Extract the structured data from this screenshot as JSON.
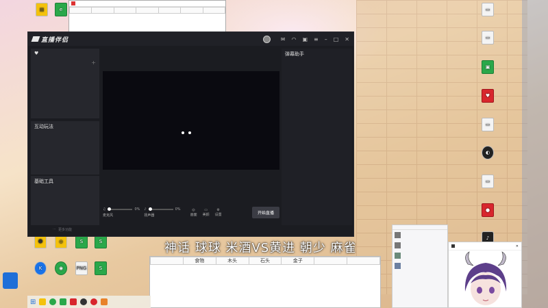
{
  "top_table": {
    "columns": [
      "",
      "",
      "",
      "",
      "",
      "",
      ""
    ]
  },
  "app": {
    "logo_text": "直播伴侣",
    "left_bottom_btn": "更多功能",
    "section_interactive": "互动玩法",
    "section_basic_tools": "基础工具",
    "right_title": "弹幕助手",
    "right_status": "",
    "ctrl_mic_label": "麦克风",
    "ctrl_mic_value": "0%",
    "ctrl_speaker_label": "扬声器",
    "ctrl_speaker_value": "0%",
    "ctrl_screen": "画面",
    "ctrl_effect": "美颜",
    "ctrl_settings": "设置",
    "start_button": "开始直播"
  },
  "banner": {
    "text": "神话 球球 米酒VS黄进 朝少 麻雀"
  },
  "bottom_table": {
    "columns": [
      "",
      "食物",
      "木头",
      "石头",
      "金子",
      "",
      ""
    ]
  },
  "friends": {
    "items": []
  },
  "anime_window": {
    "title": ""
  },
  "colors": {
    "app_bg": "#1b1c21",
    "panel_bg": "#26272d",
    "accent": "#2aa84a"
  }
}
